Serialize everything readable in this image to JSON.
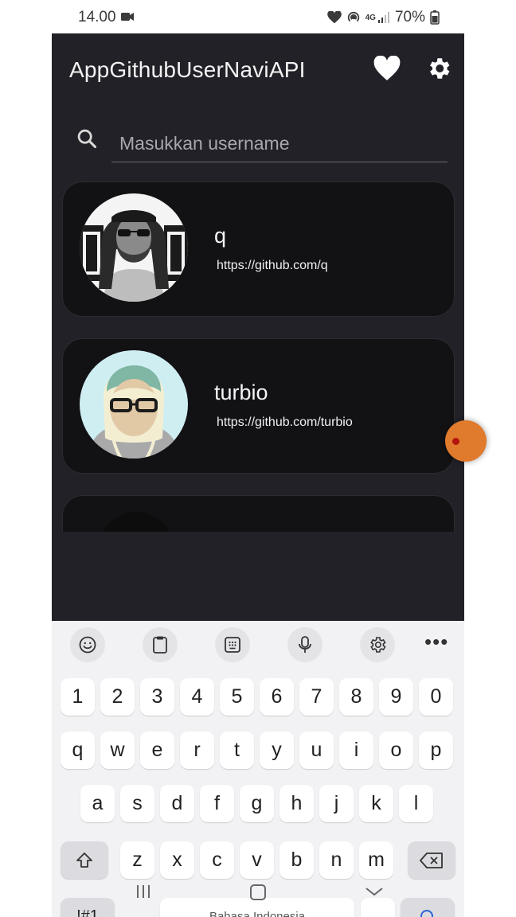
{
  "status_bar": {
    "time": "14.00",
    "network": "4G",
    "battery": "70%"
  },
  "app": {
    "title": "AppGithubUserNaviAPI",
    "favorites_icon": "heart-icon",
    "settings_icon": "gear-icon",
    "search": {
      "placeholder": "Masukkan username",
      "value": ""
    },
    "users": [
      {
        "name": "q",
        "url": "https://github.com/q"
      },
      {
        "name": "turbio",
        "url": "https://github.com/turbio"
      }
    ]
  },
  "keyboard": {
    "toolbar": [
      "emoji-icon",
      "clipboard-icon",
      "keypad-icon",
      "mic-icon",
      "gear-icon",
      "more-icon"
    ],
    "more_label": "•••",
    "row_numbers": [
      "1",
      "2",
      "3",
      "4",
      "5",
      "6",
      "7",
      "8",
      "9",
      "0"
    ],
    "row1": [
      "q",
      "w",
      "e",
      "r",
      "t",
      "y",
      "u",
      "i",
      "o",
      "p"
    ],
    "row2": [
      "a",
      "s",
      "d",
      "f",
      "g",
      "h",
      "j",
      "k",
      "l"
    ],
    "row3": [
      "z",
      "x",
      "c",
      "v",
      "b",
      "n",
      "m"
    ],
    "symbols_label": "!#1",
    "space_label": "Bahasa Indonesia"
  },
  "colors": {
    "app_bg": "#222127",
    "card_bg": "#121114",
    "keyboard_bg": "#f2f2f4",
    "accent_dot": "#e07a2d"
  }
}
